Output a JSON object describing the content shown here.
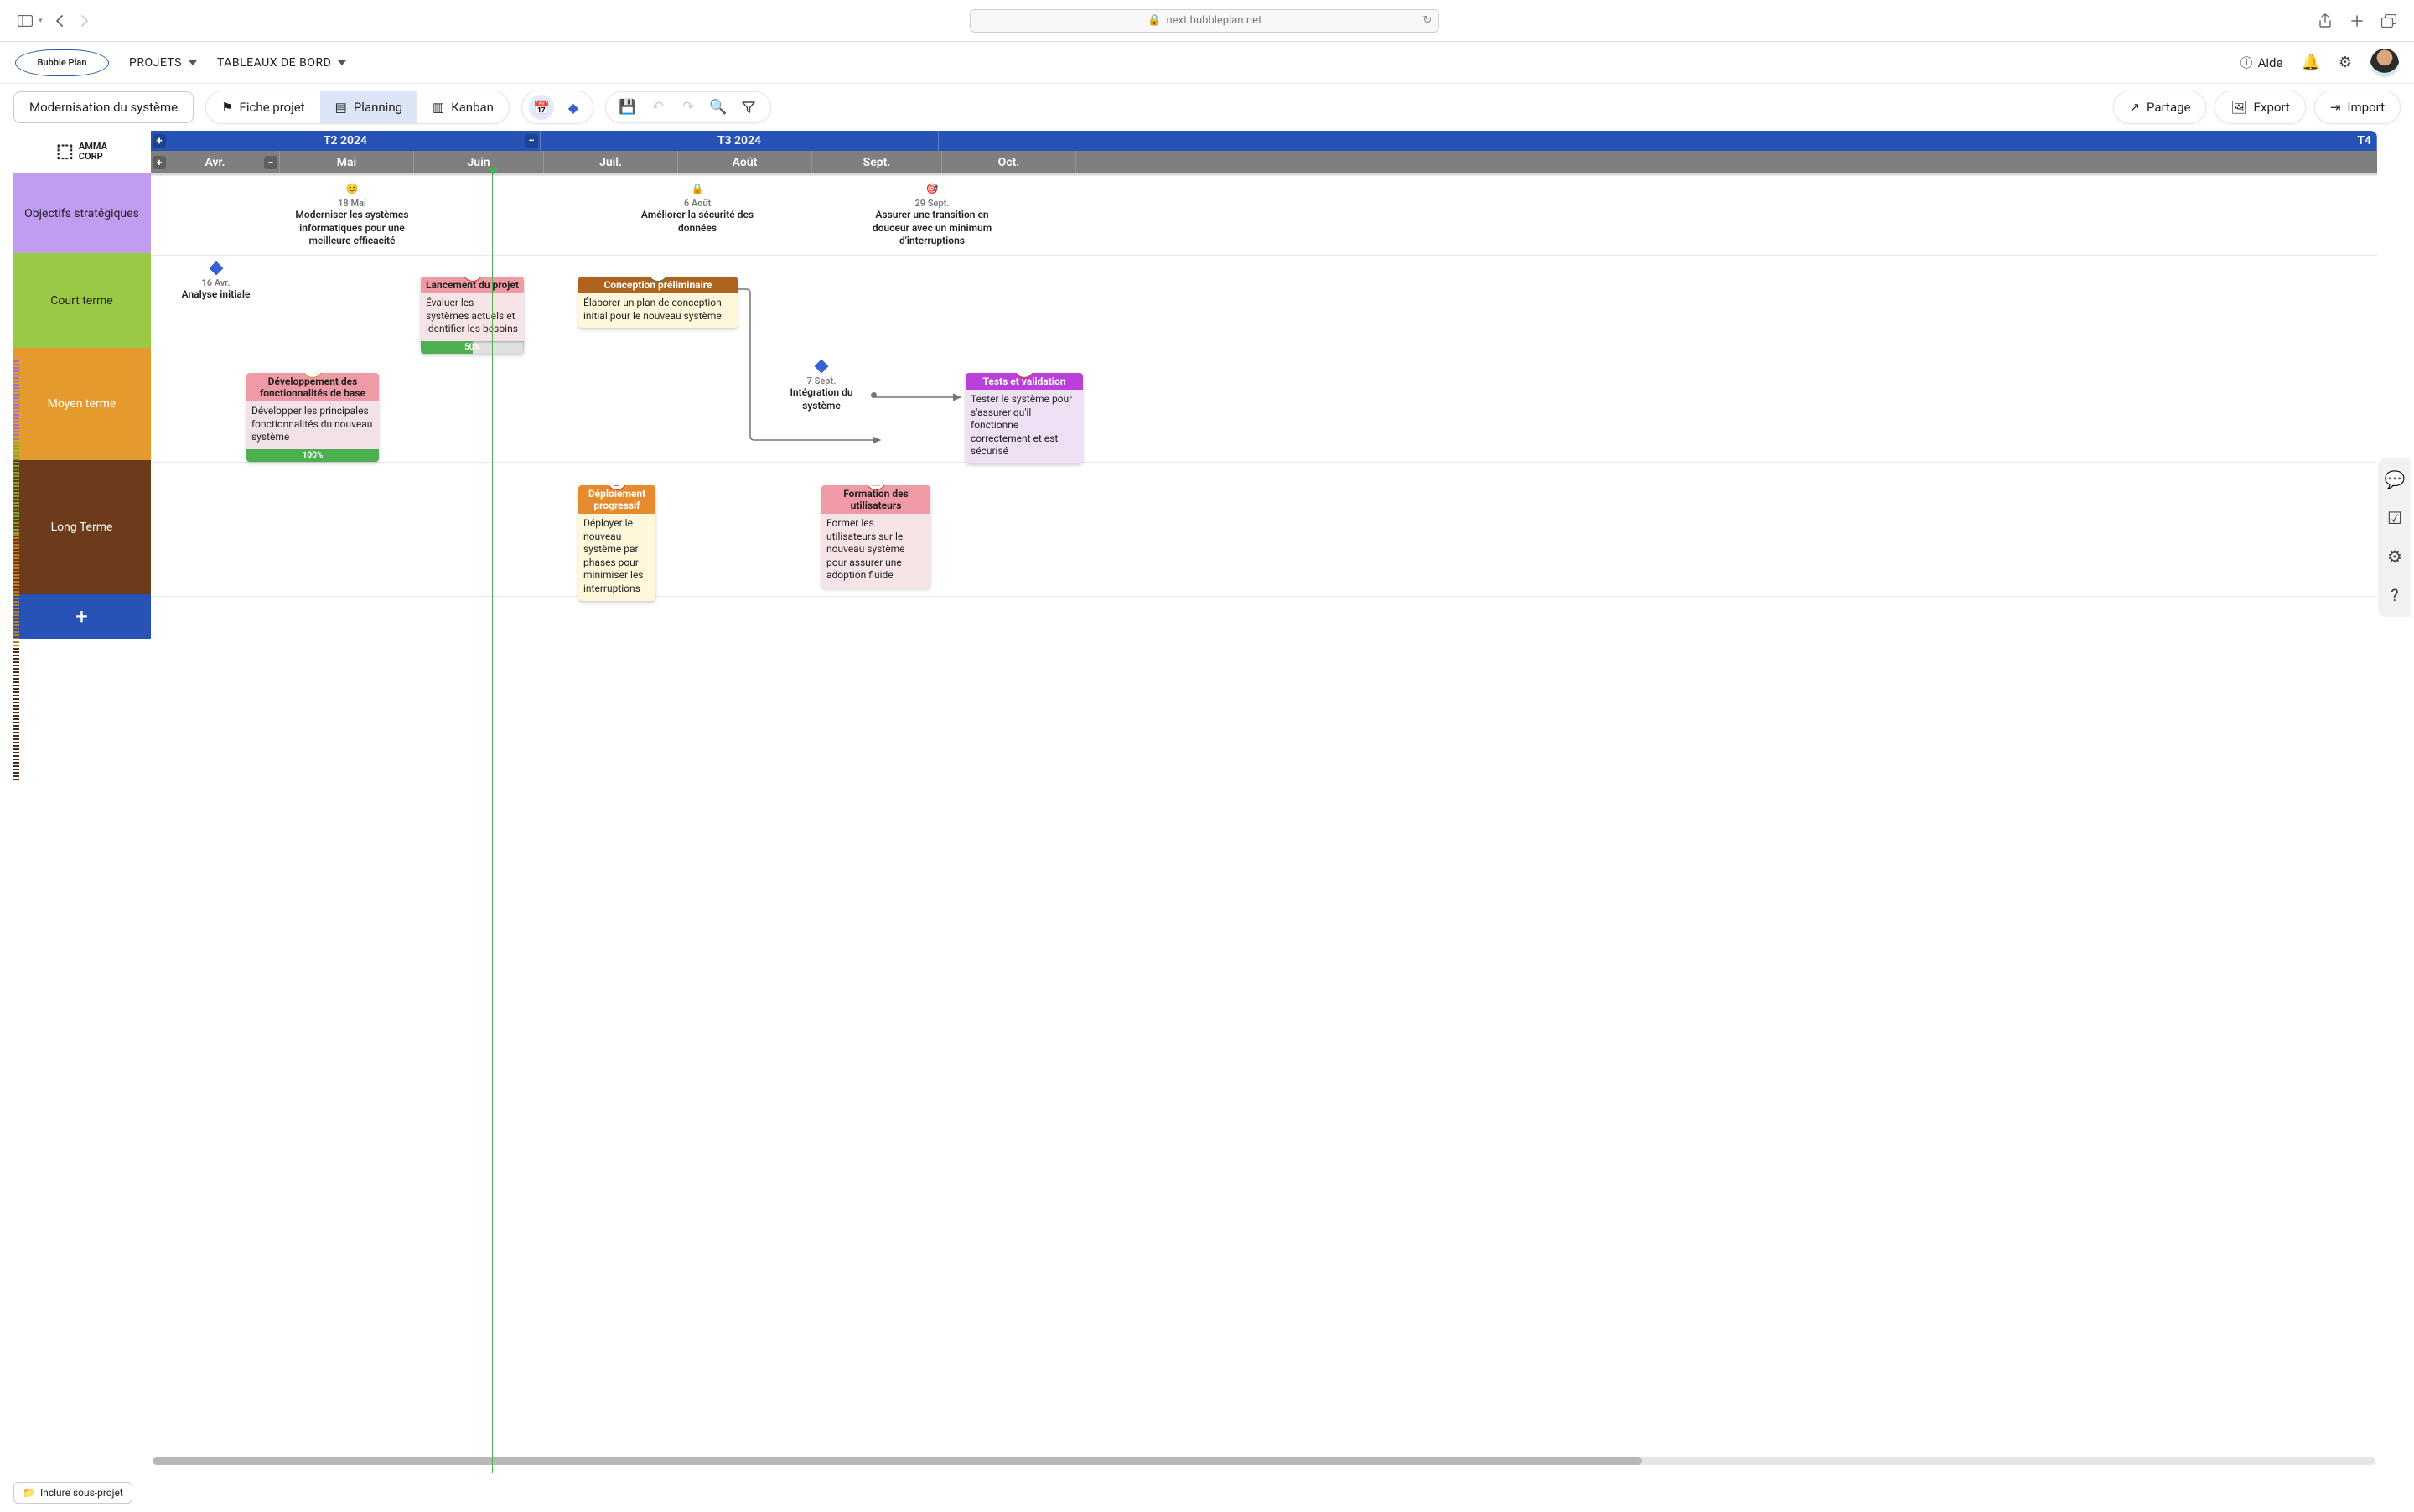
{
  "browser": {
    "url": "next.bubbleplan.net"
  },
  "app": {
    "logo": "Bubble Plan",
    "nav": [
      "PROJETS",
      "TABLEAUX DE BORD"
    ],
    "help": "Aide"
  },
  "toolbar": {
    "projectName": "Modernisation du système",
    "tabs": {
      "fiche": "Fiche projet",
      "planning": "Planning",
      "kanban": "Kanban"
    },
    "actions": {
      "share": "Partage",
      "export": "Export",
      "import": "Import"
    }
  },
  "sidebar": {
    "corpName": "AMMA\nCORP",
    "rows": [
      "Objectifs stratégiques",
      "Court terme",
      "Moyen terme",
      "Long Terme"
    ]
  },
  "timeline": {
    "quarters": [
      "T2 2024",
      "T3 2024",
      "T4"
    ],
    "months": [
      "Avr.",
      "Mai",
      "Juin",
      "Juil.",
      "Août",
      "Sept.",
      "Oct."
    ]
  },
  "strategic": [
    {
      "date": "18 Mai",
      "text": "Moderniser les systèmes informatiques pour une meilleure efficacité",
      "icon": "😊",
      "color": "#4caf50"
    },
    {
      "date": "6 Août",
      "text": "Améliorer la sécurité des données",
      "icon": "🔒",
      "color": "#d9342b"
    },
    {
      "date": "29 Sept.",
      "text": "Assurer une transition en douceur avec un minimum d'interruptions",
      "icon": "🎯",
      "color": "#4caf50"
    }
  ],
  "court": {
    "analysis": {
      "date": "16 Avr.",
      "text": "Analyse initiale"
    },
    "launch": {
      "title": "Lancement du projet",
      "body": "Évaluer les systèmes actuels et identifier les besoins",
      "progress": "50%"
    },
    "concept": {
      "title": "Conception préliminaire",
      "body": "Élaborer un plan de conception initial pour le nouveau système"
    }
  },
  "moyen": {
    "dev": {
      "title": "Développement des fonctionnalités de base",
      "body": "Développer les principales fonctionnalités du nouveau système",
      "progress": "100%"
    },
    "integ": {
      "date": "7 Sept.",
      "text": "Intégration du système"
    },
    "tests": {
      "title": "Tests et validation",
      "body": "Tester le système pour s'assurer qu'il fonctionne correctement et est sécurisé"
    }
  },
  "long": {
    "deploy": {
      "title": "Déploiement progressif",
      "body": "Déployer le nouveau système par phases pour minimiser les interruptions"
    },
    "formation": {
      "title": "Formation des utilisateurs",
      "body": "Former les utilisateurs sur le nouveau système pour assurer une adoption fluide"
    }
  },
  "footer": {
    "includeSub": "Inclure sous-projet"
  }
}
